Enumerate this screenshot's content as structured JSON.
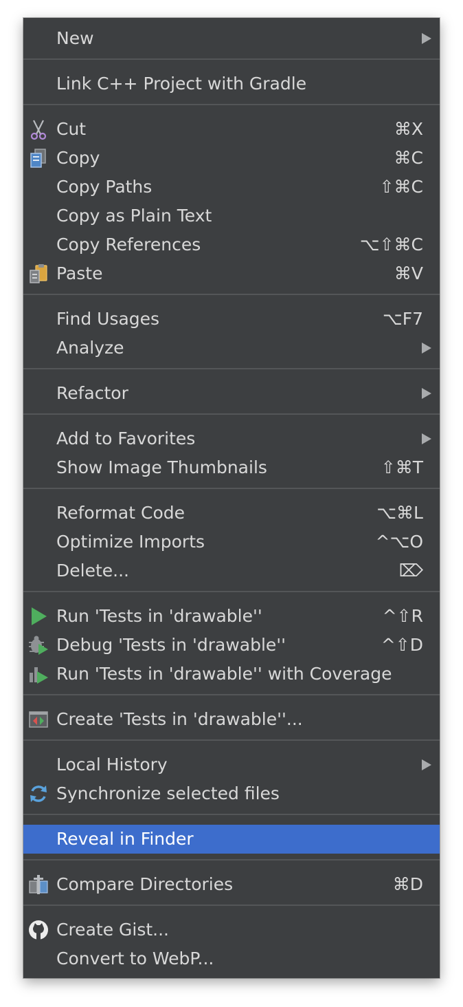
{
  "menu": {
    "items": [
      {
        "label": "New",
        "shortcut": "",
        "submenu": true
      },
      {
        "label": "Link C++ Project with Gradle",
        "shortcut": ""
      },
      {
        "label": "Cut",
        "shortcut": "⌘X",
        "icon": "scissors-icon"
      },
      {
        "label": "Copy",
        "shortcut": "⌘C",
        "icon": "copy-icon"
      },
      {
        "label": "Copy Paths",
        "shortcut": "⇧⌘C"
      },
      {
        "label": "Copy as Plain Text",
        "shortcut": ""
      },
      {
        "label": "Copy References",
        "shortcut": "⌥⇧⌘C"
      },
      {
        "label": "Paste",
        "shortcut": "⌘V",
        "icon": "paste-icon"
      },
      {
        "label": "Find Usages",
        "shortcut": "⌥F7"
      },
      {
        "label": "Analyze",
        "shortcut": "",
        "submenu": true
      },
      {
        "label": "Refactor",
        "shortcut": "",
        "submenu": true
      },
      {
        "label": "Add to Favorites",
        "shortcut": "",
        "submenu": true
      },
      {
        "label": "Show Image Thumbnails",
        "shortcut": "⇧⌘T"
      },
      {
        "label": "Reformat Code",
        "shortcut": "⌥⌘L"
      },
      {
        "label": "Optimize Imports",
        "shortcut": "^⌥O"
      },
      {
        "label": "Delete...",
        "shortcut": "⌦"
      },
      {
        "label": "Run 'Tests in 'drawable''",
        "shortcut": "^⇧R",
        "icon": "run-icon"
      },
      {
        "label": "Debug 'Tests in 'drawable''",
        "shortcut": "^⇧D",
        "icon": "debug-icon"
      },
      {
        "label": "Run 'Tests in 'drawable'' with Coverage",
        "shortcut": "",
        "icon": "coverage-icon"
      },
      {
        "label": "Create 'Tests in 'drawable''...",
        "shortcut": "",
        "icon": "create-test-icon"
      },
      {
        "label": "Local History",
        "shortcut": "",
        "submenu": true
      },
      {
        "label": "Synchronize selected files",
        "shortcut": "",
        "icon": "sync-icon"
      },
      {
        "label": "Reveal in Finder",
        "shortcut": "",
        "selected": true
      },
      {
        "label": "Compare Directories",
        "shortcut": "⌘D",
        "icon": "compare-icon"
      },
      {
        "label": "Create Gist...",
        "shortcut": "",
        "icon": "github-icon"
      },
      {
        "label": "Convert to WebP...",
        "shortcut": ""
      }
    ],
    "colors": {
      "background": "#3d3f41",
      "text": "#d8d8d8",
      "selection": "#3d6dcc",
      "separator": "#545658"
    }
  }
}
